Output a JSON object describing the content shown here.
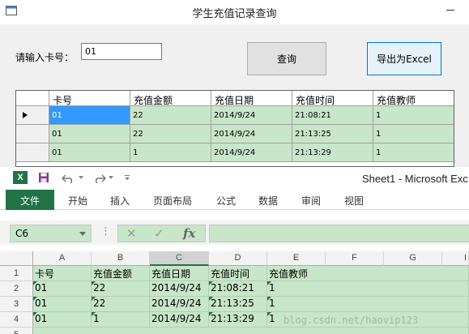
{
  "query_window": {
    "title": "学生充值记录查询",
    "card_label": "请输入卡号：",
    "card_value": "01",
    "query_button": "查询",
    "export_button": "导出为Excel",
    "grid": {
      "columns": [
        "卡号",
        "充值金额",
        "充值日期",
        "充值时间",
        "充值教师"
      ],
      "rows": [
        [
          "01",
          "22",
          "2014/9/24",
          "21:08:21",
          "1"
        ],
        [
          "01",
          "22",
          "2014/9/24",
          "21:13:25",
          "1"
        ],
        [
          "01",
          "1",
          "2014/9/24",
          "21:13:29",
          "1"
        ]
      ]
    }
  },
  "excel": {
    "window_title": "Sheet1 - Microsoft Exc",
    "tabs": [
      "文件",
      "开始",
      "插入",
      "页面布局",
      "公式",
      "数据",
      "审阅",
      "视图"
    ],
    "name_box": "C6",
    "name_box_dots": "⋮",
    "fx_cancel": "✕",
    "fx_enter": "✓",
    "fx_label": "fx",
    "column_headers": [
      "A",
      "B",
      "C",
      "D",
      "E",
      "F",
      "G",
      "I"
    ],
    "row_headers": [
      "1",
      "2",
      "3",
      "4",
      "5"
    ],
    "rows": [
      [
        "卡号",
        "充值金额",
        "充值日期",
        "充值时间",
        "充值教师"
      ],
      [
        "01",
        "22",
        "2014/9/24",
        "21:08:21",
        "1"
      ],
      [
        "01",
        "22",
        "2014/9/24",
        "21:13:25",
        "1"
      ],
      [
        "01",
        "1",
        "2014/9/24",
        "21:13:29",
        "1"
      ]
    ],
    "watermark": "blog.csdn.net/haovip123"
  },
  "colors": {
    "row_green": "#c8e6c9",
    "excel_green": "#217346",
    "selection_blue": "#3399ff"
  }
}
